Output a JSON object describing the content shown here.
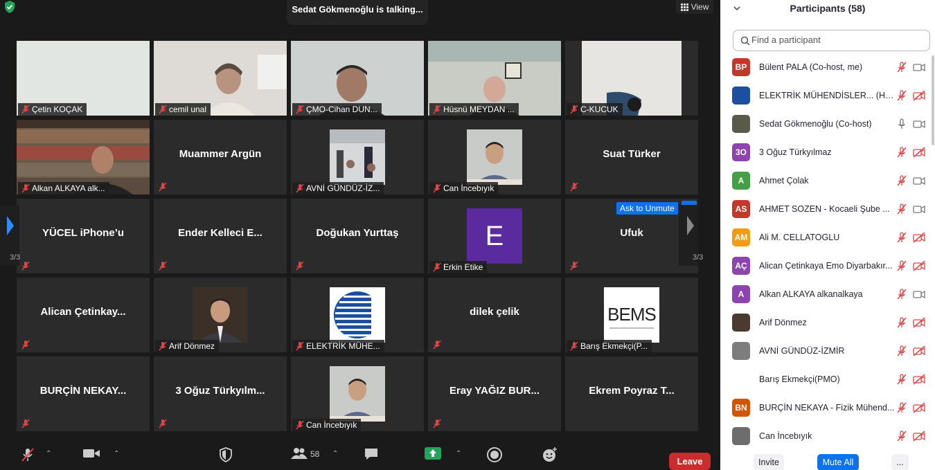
{
  "meeting": {
    "talking_banner": "Sedat Gökmenoğlu is talking...",
    "view_label": "View",
    "page_left": "3/3",
    "page_right": "3/3",
    "unmute_tip": "Ask to Unmute"
  },
  "tiles": {
    "t1": "Çetin KOÇAK",
    "t2": "cemil unal",
    "t3": "ÇMO-Cihan DUN...",
    "t4": "Hüsnü MEYDAN ...",
    "t5": "C-KUCUK",
    "t6": "Alkan ALKAYA alk...",
    "t7": "Muammer Argün",
    "t8": "AVNİ GÜNDÜZ-İZ...",
    "t9": "Can İncebıyık",
    "t10": "Suat Türker",
    "t11": "YÜCEL iPhone’u",
    "t12": "Ender Kelleci E...",
    "t13": "Doğukan Yurttaş",
    "t14_letter": "E",
    "t14": "Erkin Etike",
    "t15": "Ufuk",
    "t16": "Alican Çetinkay...",
    "t17": "Arif Dönmez",
    "t18": "ELEKTRİK MÜHE...",
    "t19": "dilek çelik",
    "t20": "Barış Ekmekçi(P...",
    "t21": "BURÇİN NEKAY...",
    "t22": "3 Oğuz Türkyılm...",
    "t23": "Can İncebıyık",
    "t24": "Eray YAĞIZ BUR...",
    "t25": "Ekrem Poyraz T..."
  },
  "bems_logo": "BEMS",
  "toolbar": {
    "participants_count": "58",
    "leave": "Leave"
  },
  "panel": {
    "title": "Participants (58)",
    "search_placeholder": "Find a participant",
    "participants": [
      {
        "initials": "BP",
        "name": "Bülent PALA (Co-host, me)",
        "color": "#c0392b"
      },
      {
        "initials": "",
        "name": "ELEKTRİK MÜHENDİSLER... (Host)",
        "color": "#1b4fa0"
      },
      {
        "initials": "",
        "name": "Sedat Gökmenoğlu (Co-host)",
        "color": "#5a5a4a"
      },
      {
        "initials": "3O",
        "name": "3 Oğuz Türkyılmaz",
        "color": "#8e44ad"
      },
      {
        "initials": "A",
        "name": "Ahmet Çolak",
        "color": "#43a047"
      },
      {
        "initials": "AS",
        "name": "AHMET SOZEN - Kocaeli Şube ...",
        "color": "#c0392b"
      },
      {
        "initials": "AM",
        "name": "Ali M. CELLATOGLU",
        "color": "#f39c12"
      },
      {
        "initials": "AÇ",
        "name": "Alican Çetinkaya Emo Diyarbakır...",
        "color": "#8e44ad"
      },
      {
        "initials": "A",
        "name": "Alkan ALKAYA alkanalkaya",
        "color": "#8e44ad"
      },
      {
        "initials": "",
        "name": "Arif Dönmez",
        "color": "#4a3a30"
      },
      {
        "initials": "",
        "name": "AVNİ GÜNDÜZ-İZMİR",
        "color": "#7d7d7d"
      },
      {
        "initials": "",
        "name": "Barış Ekmekçi(PMO)",
        "color": "#ffffff"
      },
      {
        "initials": "BN",
        "name": "BURÇİN NEKAYA - Fizik Mühend...",
        "color": "#d35400"
      },
      {
        "initials": "",
        "name": "Can İncebıyık",
        "color": "#6d6d6d"
      }
    ],
    "invite": "Invite",
    "mute_all": "Mute All",
    "more": "..."
  }
}
